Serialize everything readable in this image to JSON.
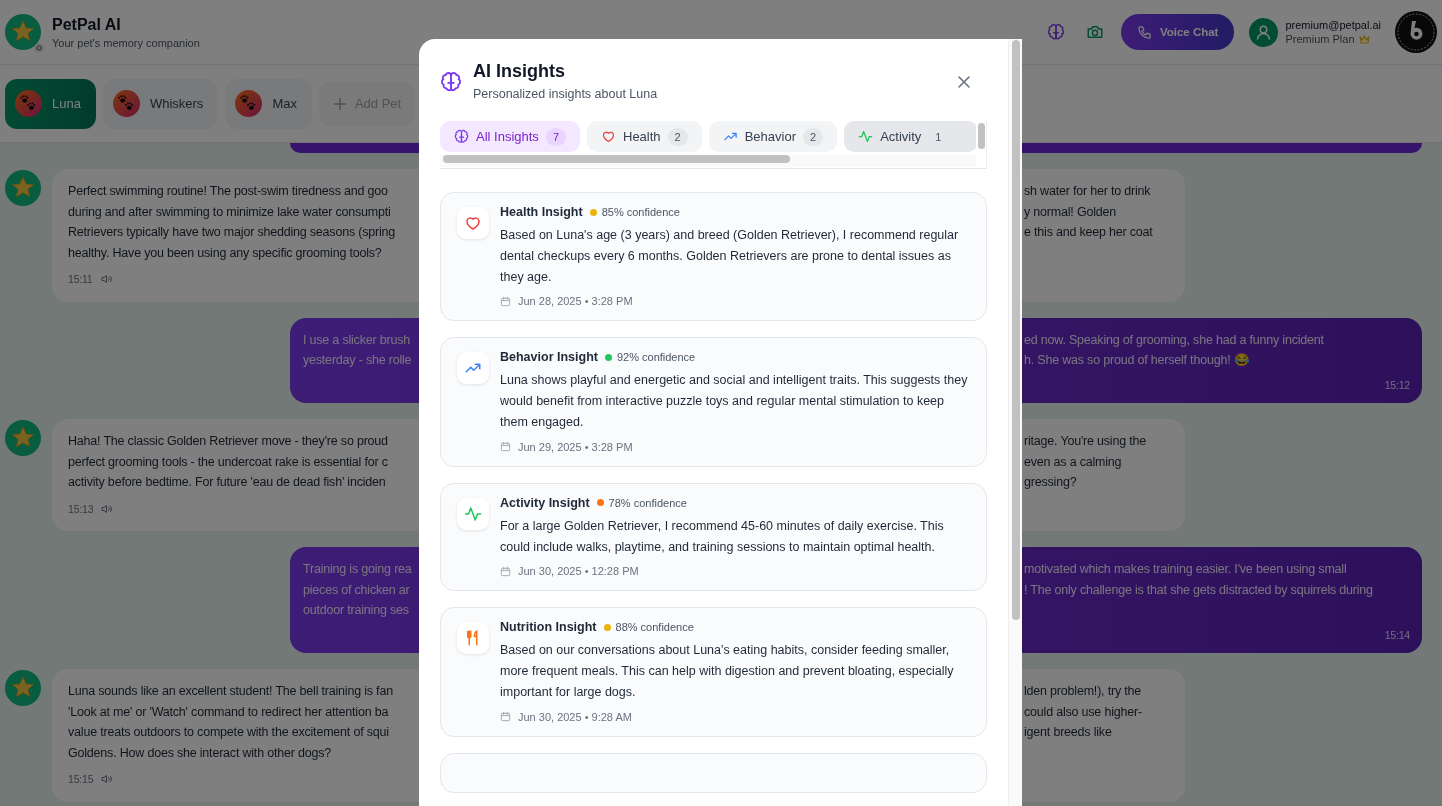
{
  "header": {
    "title": "PetPal AI",
    "subtitle": "Your pet's memory companion",
    "voice_button": "Voice Chat",
    "user": {
      "email": "premium@petpal.ai",
      "plan": "Premium Plan"
    }
  },
  "pets": [
    {
      "name": "Luna",
      "selected": true
    },
    {
      "name": "Whiskers",
      "selected": false
    },
    {
      "name": "Max",
      "selected": false
    }
  ],
  "add_pet": "Add Pet",
  "messages": [
    {
      "kind": "assistant",
      "left_lines": [
        "Perfect swimming routine! The post-swim tiredness and goo",
        "during and after swimming to minimize lake water consumpti",
        "Retrievers typically have two major shedding seasons (spring",
        "healthy. Have you been using any specific grooming tools?"
      ],
      "right_lines": [
        "sh water for her to drink",
        "y normal! Golden",
        "e this and keep her coat"
      ],
      "time": "15:11"
    },
    {
      "kind": "user",
      "left_lines": [
        "I use a slicker brush",
        "yesterday - she rolle"
      ],
      "right_lines": [
        "ed now. Speaking of grooming, she had a funny incident",
        "h. She was so proud of herself though! 😂"
      ],
      "time": "15:12"
    },
    {
      "kind": "assistant",
      "left_lines": [
        "Haha! The classic Golden Retriever move - they're so proud",
        "perfect grooming tools - the undercoat rake is essential for c",
        "activity before bedtime. For future 'eau de dead fish' inciden"
      ],
      "right_lines": [
        "ritage. You're using the",
        "even as a calming",
        "gressing?"
      ],
      "time": "15:13"
    },
    {
      "kind": "user",
      "left_lines": [
        "Training is going rea",
        "pieces of chicken ar",
        "outdoor training ses"
      ],
      "right_lines": [
        "motivated which makes training easier. I've been using small",
        "! The only challenge is that she gets distracted by squirrels during"
      ],
      "time": "15:14"
    },
    {
      "kind": "assistant",
      "left_lines": [
        "Luna sounds like an excellent student! The bell training is fan",
        "'Look at me' or 'Watch' command to redirect her attention ba",
        "value treats outdoors to compete with the excitement of squi",
        "Goldens. How does she interact with other dogs?"
      ],
      "right_lines": [
        "lden problem!), try the",
        "could also use higher-",
        "igent breeds like"
      ],
      "time": "15:15"
    }
  ],
  "modal": {
    "title": "AI Insights",
    "subtitle": "Personalized insights about Luna",
    "filters": [
      {
        "kind": "all",
        "label": "All Insights",
        "count": "7",
        "selected": true
      },
      {
        "kind": "health",
        "label": "Health",
        "count": "2",
        "selected": false
      },
      {
        "kind": "behavior",
        "label": "Behavior",
        "count": "2",
        "selected": false
      },
      {
        "kind": "activity",
        "label": "Activity",
        "count": "1",
        "selected": false
      }
    ],
    "insights": [
      {
        "kind": "health",
        "title": "Health Insight",
        "color": "#eab308",
        "confidence": "85% confidence",
        "text": "Based on Luna's age (3 years) and breed (Golden Retriever), I recommend regular dental checkups every 6 months. Golden Retrievers are prone to dental issues as they age.",
        "date": "Jun 28, 2025 • 3:28 PM"
      },
      {
        "kind": "behavior",
        "title": "Behavior Insight",
        "color": "#22c55e",
        "confidence": "92% confidence",
        "text": "Luna shows playful and energetic and social and intelligent traits. This suggests they would benefit from interactive puzzle toys and regular mental stimulation to keep them engaged.",
        "date": "Jun 29, 2025 • 3:28 PM"
      },
      {
        "kind": "activity",
        "title": "Activity Insight",
        "color": "#f97316",
        "confidence": "78% confidence",
        "text": "For a large Golden Retriever, I recommend 45-60 minutes of daily exercise. This could include walks, playtime, and training sessions to maintain optimal health.",
        "date": "Jun 30, 2025 • 12:28 PM"
      },
      {
        "kind": "nutrition",
        "title": "Nutrition Insight",
        "color": "#eab308",
        "confidence": "88% confidence",
        "text": "Based on our conversations about Luna's eating habits, consider feeding smaller, more frequent meals. This can help with digestion and prevent bloating, especially important for large dogs.",
        "date": "Jun 30, 2025 • 9:28 AM"
      }
    ]
  }
}
